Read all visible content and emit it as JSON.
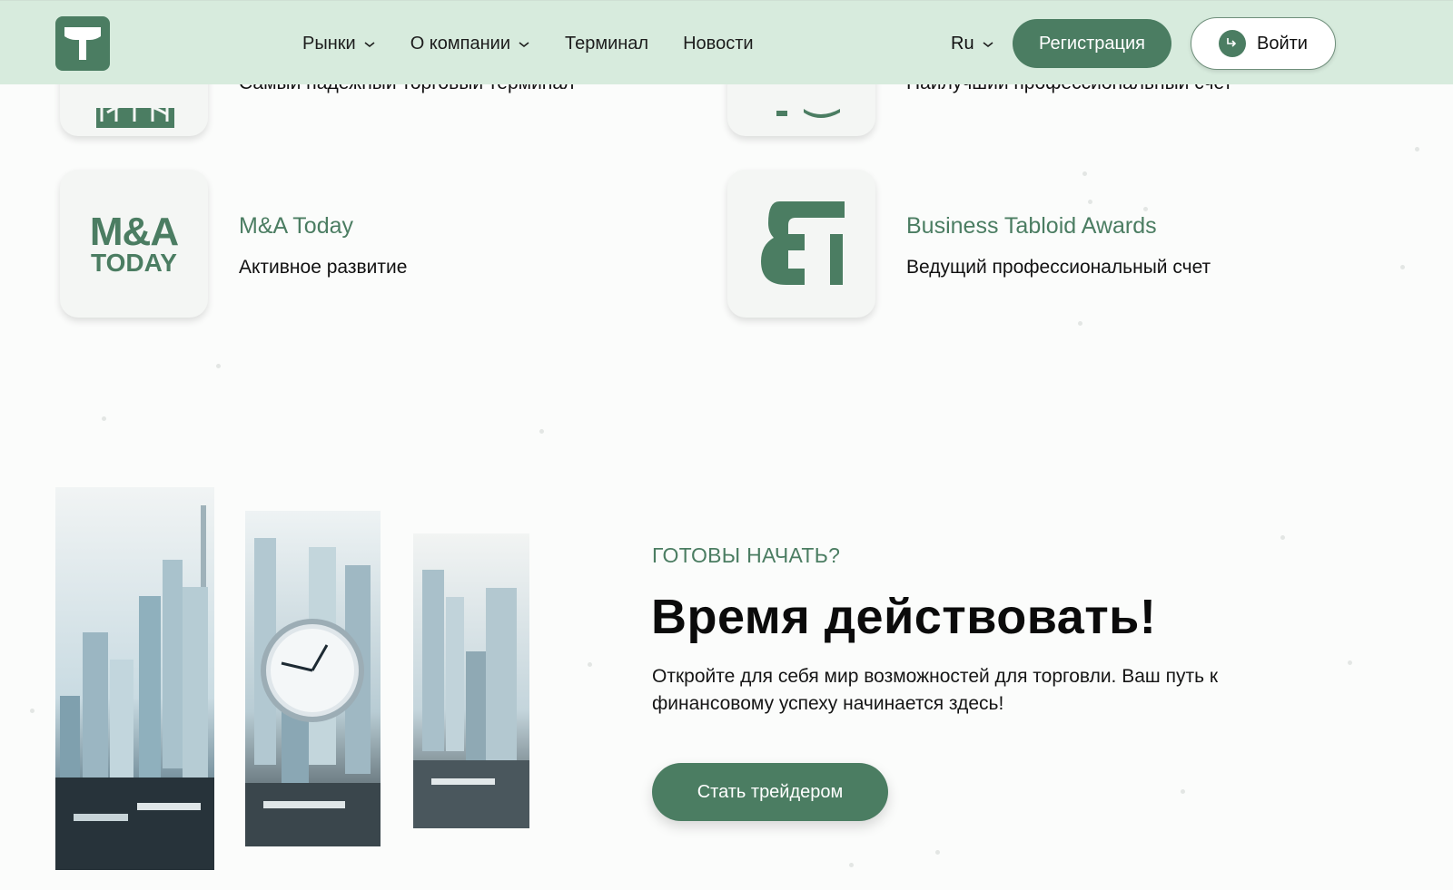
{
  "header": {
    "logo_alt": "T",
    "nav": [
      {
        "label": "Рынки",
        "has_dropdown": true
      },
      {
        "label": "О компании",
        "has_dropdown": true
      },
      {
        "label": "Терминал",
        "has_dropdown": false
      },
      {
        "label": "Новости",
        "has_dropdown": false
      }
    ],
    "language": "Ru",
    "register_label": "Регистрация",
    "login_label": "Войти"
  },
  "awards": [
    {
      "title": "",
      "subtitle": "Самый надежный торговый терминал",
      "icon": "globe-logo"
    },
    {
      "title": "",
      "subtitle": "Наилучший профессиональный счет",
      "icon": "fe-logo"
    },
    {
      "title": "M&A Today",
      "subtitle": "Активное развитие",
      "icon": "ma-today-logo",
      "logo_text_1": "M&A",
      "logo_text_2": "TODAY"
    },
    {
      "title": "Business Tabloid Awards",
      "subtitle": "Ведущий профессиональный счет",
      "icon": "bt-logo"
    }
  ],
  "cta": {
    "eyebrow": "ГОТОВЫ НАЧАТЬ?",
    "headline": "Время действовать!",
    "description": "Откройте для себя мир возможностей для торговли. Ваш путь к финансовому успеху начинается здесь!",
    "button_label": "Стать трейдером"
  },
  "colors": {
    "accent": "#4b7d62",
    "header_bg": "#d7ebdd",
    "page_bg": "#fbfcfb"
  }
}
